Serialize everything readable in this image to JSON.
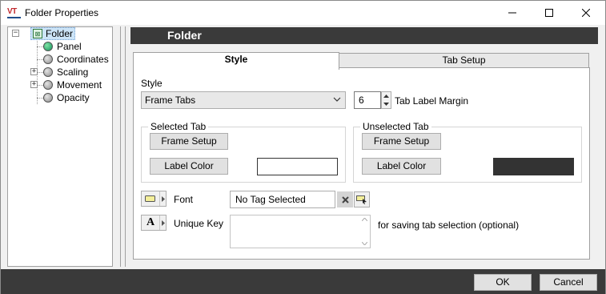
{
  "window": {
    "title": "Folder Properties",
    "logo_text": "VT"
  },
  "tree": {
    "root": "Folder",
    "items": [
      {
        "label": "Panel",
        "icon": "green-dot-icon"
      },
      {
        "label": "Coordinates",
        "icon": "grey-dot-icon"
      },
      {
        "label": "Scaling",
        "icon": "grey-dot-icon",
        "expandable": true
      },
      {
        "label": "Movement",
        "icon": "grey-dot-icon",
        "expandable": true
      },
      {
        "label": "Opacity",
        "icon": "grey-dot-icon"
      }
    ]
  },
  "header": {
    "title": "Folder"
  },
  "tabs": [
    {
      "label": "Style",
      "active": true
    },
    {
      "label": "Tab Setup",
      "active": false
    }
  ],
  "style": {
    "section_label": "Style",
    "combo_value": "Frame Tabs",
    "margin_value": "6",
    "margin_label": "Tab Label Margin"
  },
  "selected_tab": {
    "title": "Selected Tab",
    "frame_setup": "Frame Setup",
    "label_color": "Label Color",
    "color": "#ffffff"
  },
  "unselected_tab": {
    "title": "Unselected Tab",
    "frame_setup": "Frame Setup",
    "label_color": "Label Color",
    "color": "#333333"
  },
  "font": {
    "label": "Font",
    "value": "No Tag Selected"
  },
  "unique_key": {
    "label": "Unique Key",
    "value": "",
    "hint": "for saving tab selection (optional)"
  },
  "dialog": {
    "ok": "OK",
    "cancel": "Cancel"
  },
  "colors": {
    "header_bg": "#3a3a3a",
    "tree_selection": "#cce4f7"
  }
}
